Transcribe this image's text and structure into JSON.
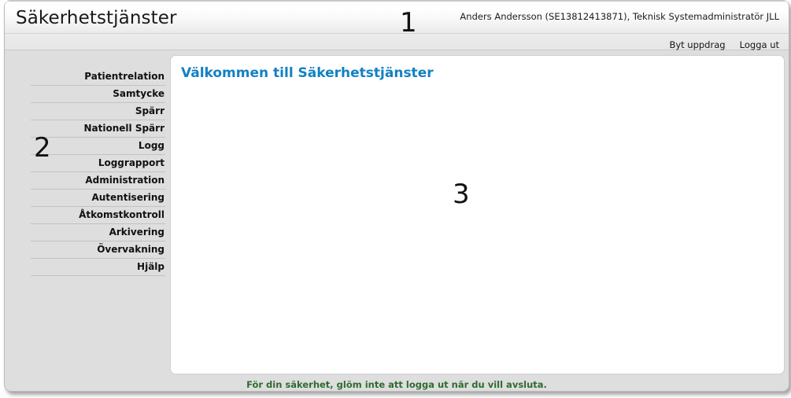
{
  "header": {
    "app_title": "Säkerhetstjänster",
    "user_info": "Anders Andersson (SE13812413871), Teknisk Systemadministratör JLL",
    "links": [
      {
        "label": "Byt uppdrag"
      },
      {
        "label": "Logga ut"
      }
    ]
  },
  "sidebar": {
    "items": [
      {
        "label": "Patientrelation"
      },
      {
        "label": "Samtycke"
      },
      {
        "label": "Spärr"
      },
      {
        "label": "Nationell Spärr"
      },
      {
        "label": "Logg"
      },
      {
        "label": "Loggrapport"
      },
      {
        "label": "Administration"
      },
      {
        "label": "Autentisering"
      },
      {
        "label": "Åtkomstkontroll"
      },
      {
        "label": "Arkivering"
      },
      {
        "label": "Övervakning"
      },
      {
        "label": "Hjälp"
      }
    ]
  },
  "main": {
    "heading": "Välkommen till Säkerhetstjänster"
  },
  "footer": {
    "text": "För din säkerhet, glöm inte att logga ut när du vill avsluta."
  },
  "annotations": [
    {
      "label": "1"
    },
    {
      "label": "2"
    },
    {
      "label": "3"
    }
  ],
  "colors": {
    "heading_blue": "#1281c4",
    "footer_green": "#2f6b2f",
    "page_background": "#dedede",
    "panel_background": "#ffffff"
  }
}
